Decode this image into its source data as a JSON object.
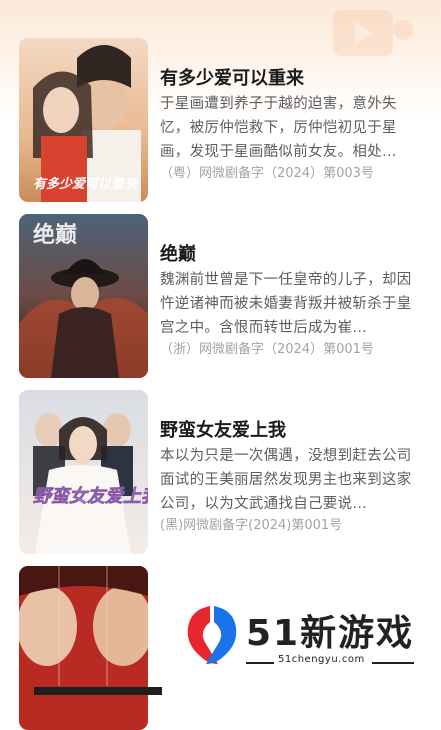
{
  "dramas": [
    {
      "title": "有多少爱可以重来",
      "description": "于星画遭到养子于越的迫害，意外失忆，被厉仲恺救下，厉仲恺初见于星画，发现于星画酷似前女友。相处…",
      "license": "（粤）网微剧备字（2024）第003号",
      "poster_text": "有多少爱可以重来"
    },
    {
      "title": "绝巅",
      "description": "魏渊前世曾是下一任皇帝的儿子，却因忤逆诸神而被未婚妻背叛并被斩杀于皇宫之中。含恨而转世后成为崔…",
      "license": "（浙）网微剧备字（2024）第001号",
      "poster_text": "绝巅"
    },
    {
      "title": "野蛮女友爱上我",
      "description": "本以为只是一次偶遇，没想到赶去公司面试的王美丽居然发现男主也来到这家公司，以为文武通找自己要说…",
      "license": "(黑)网微剧备字(2024)第001号",
      "poster_text": "野蛮女友爱上我"
    },
    {
      "title": "",
      "description": "",
      "license": "",
      "poster_text": ""
    }
  ],
  "watermark": {
    "brand": "51新游戏",
    "url": "51chengyu.com"
  },
  "colors": {
    "title": "#1b1b1b",
    "description": "#5e5e5e",
    "license": "#a3a3a3",
    "watermark_red": "#e8262d",
    "watermark_blue": "#1a73e8"
  }
}
